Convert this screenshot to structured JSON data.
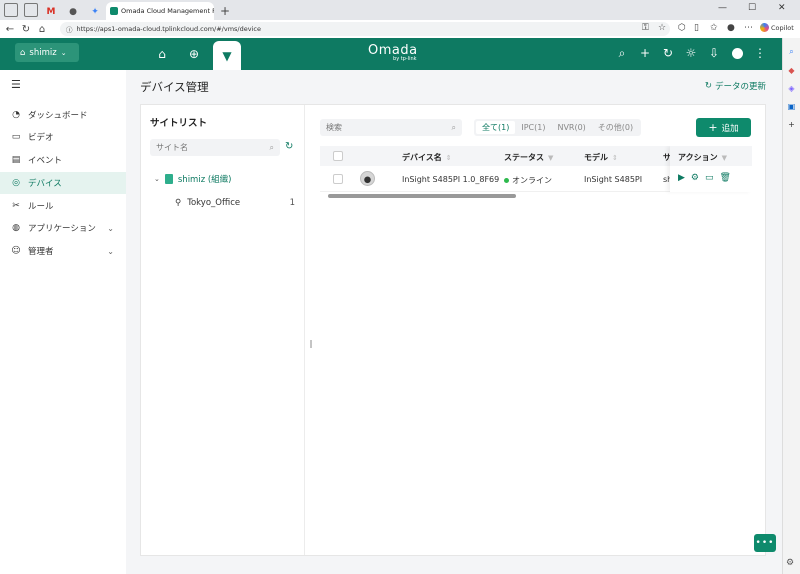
{
  "browser": {
    "tab_title": "Omada Cloud Management Platf",
    "mini_tab_labels": [
      "M",
      "●"
    ],
    "url": "https://aps1-omada-cloud.tplinkcloud.com/#/vms/device",
    "copilot_label": "Copilot"
  },
  "header": {
    "site_selector": "shimiz",
    "brand": "Omada",
    "brand_sub": "by tp-link"
  },
  "sidebar": {
    "items": [
      {
        "label": "ダッシュボード",
        "icon": "dashboard-icon"
      },
      {
        "label": "ビデオ",
        "icon": "video-icon"
      },
      {
        "label": "イベント",
        "icon": "event-icon"
      },
      {
        "label": "デバイス",
        "icon": "device-icon"
      },
      {
        "label": "ルール",
        "icon": "rule-icon"
      },
      {
        "label": "アプリケーション",
        "icon": "application-icon"
      },
      {
        "label": "管理者",
        "icon": "admin-icon"
      }
    ]
  },
  "page": {
    "title": "デバイス管理",
    "refresh_label": "データの更新"
  },
  "site_list": {
    "title": "サイトリスト",
    "search_placeholder": "サイト名",
    "org_label": "shimiz (組織)",
    "sites": [
      {
        "name": "Tokyo_Office",
        "count": "1"
      }
    ]
  },
  "devices": {
    "search_placeholder": "検索",
    "filters": [
      "全て(1)",
      "IPC(1)",
      "NVR(0)",
      "その他(0)"
    ],
    "active_filter": 0,
    "add_label": "追加",
    "columns": {
      "name": "デバイス名",
      "status": "ステータス",
      "model": "モデル",
      "site": "サ",
      "actions": "アクション"
    },
    "rows": [
      {
        "name": "InSight S485PI 1.0_8F69",
        "status": "オンライン",
        "model": "InSight S485PI",
        "site": "sh"
      }
    ]
  },
  "colors": {
    "brand_green": "#0e7a62",
    "accent_green": "#0e8a6c",
    "online_green": "#2db94d"
  }
}
